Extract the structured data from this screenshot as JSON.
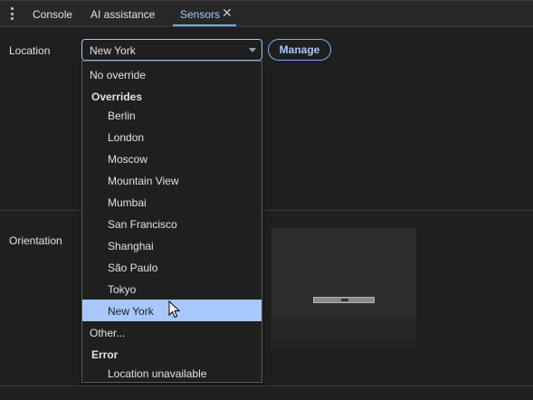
{
  "tabs": [
    {
      "label": "Console"
    },
    {
      "label": "AI assistance"
    },
    {
      "label": "Sensors"
    }
  ],
  "location": {
    "label": "Location",
    "selected_value": "New York",
    "manage_label": "Manage"
  },
  "orientation": {
    "label": "Orientation"
  },
  "dropdown": {
    "no_override": "No override",
    "overrides_group": "Overrides",
    "cities": [
      "Berlin",
      "London",
      "Moscow",
      "Mountain View",
      "Mumbai",
      "San Francisco",
      "Shanghai",
      "São Paulo",
      "Tokyo",
      "New York"
    ],
    "other": "Other...",
    "error_group": "Error",
    "error_option": "Location unavailable"
  },
  "colors": {
    "accent": "#a8c7fa",
    "background": "#1f1f1f",
    "selected_row": "#a8c7fa"
  },
  "icons": {
    "menu": "kebab-menu-icon",
    "close": "close-icon",
    "caret": "chevron-down-icon",
    "cursor": "mouse-pointer-icon"
  }
}
